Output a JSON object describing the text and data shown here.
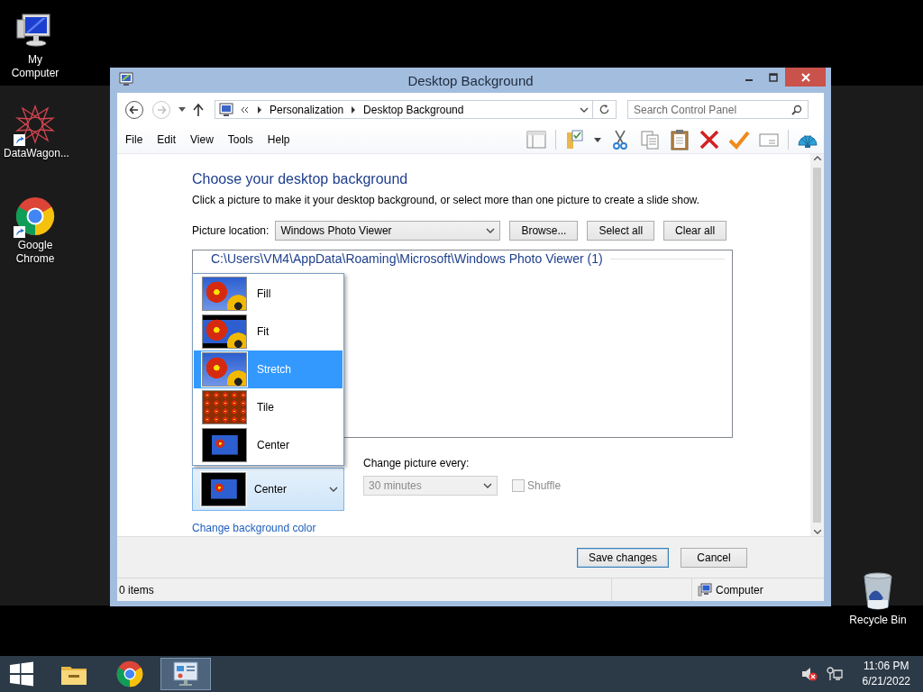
{
  "desktop_icons": [
    {
      "label": "My Computer",
      "kind": "computer",
      "shortcut": false
    },
    {
      "label": "DataWagon...",
      "kind": "starburst",
      "shortcut": true
    },
    {
      "label": "Google Chrome",
      "kind": "chrome",
      "shortcut": true
    },
    {
      "label": "Recycle Bin",
      "kind": "recycle-bin",
      "shortcut": false
    }
  ],
  "window": {
    "title": "Desktop Background",
    "breadcrumb": [
      "Personalization",
      "Desktop Background"
    ],
    "search": {
      "placeholder": "Search Control Panel"
    },
    "menu": [
      "File",
      "Edit",
      "View",
      "Tools",
      "Help"
    ],
    "heading": "Choose your desktop background",
    "description": "Click a picture to make it your desktop background, or select more than one picture to create a slide show.",
    "picture_location": {
      "label": "Picture location:",
      "value": "Windows Photo Viewer"
    },
    "buttons": [
      "Browse...",
      "Select all",
      "Clear all"
    ],
    "folder_path": "C:\\Users\\VM4\\AppData\\Roaming\\Microsoft\\Windows Photo Viewer (1)",
    "position": {
      "value": "Center",
      "options": [
        {
          "label": "Fill",
          "kind": "fill",
          "highlighted": false,
          "selected": false
        },
        {
          "label": "Fit",
          "kind": "fit",
          "highlighted": false,
          "selected": false
        },
        {
          "label": "Stretch",
          "kind": "stretch",
          "highlighted": true,
          "selected": false
        },
        {
          "label": "Tile",
          "kind": "tile",
          "highlighted": false,
          "selected": false
        },
        {
          "label": "Center",
          "kind": "center",
          "highlighted": false,
          "selected": true
        }
      ]
    },
    "change_picture": {
      "label": "Change picture every:",
      "value": "30 minutes",
      "disabled": true
    },
    "shuffle": {
      "label": "Shuffle",
      "checked": false,
      "disabled": true
    },
    "link": "Change background color",
    "actions": [
      {
        "label": "Save changes",
        "default": true
      },
      {
        "label": "Cancel",
        "default": false
      }
    ],
    "status_bar": {
      "items": "0 items",
      "zone": "Computer"
    }
  },
  "taskbar": {
    "apps": [
      {
        "kind": "folder",
        "active": false
      },
      {
        "kind": "chrome",
        "active": false
      },
      {
        "kind": "control-panel",
        "active": true
      }
    ],
    "time": "11:06 PM",
    "date": "6/21/2022"
  }
}
